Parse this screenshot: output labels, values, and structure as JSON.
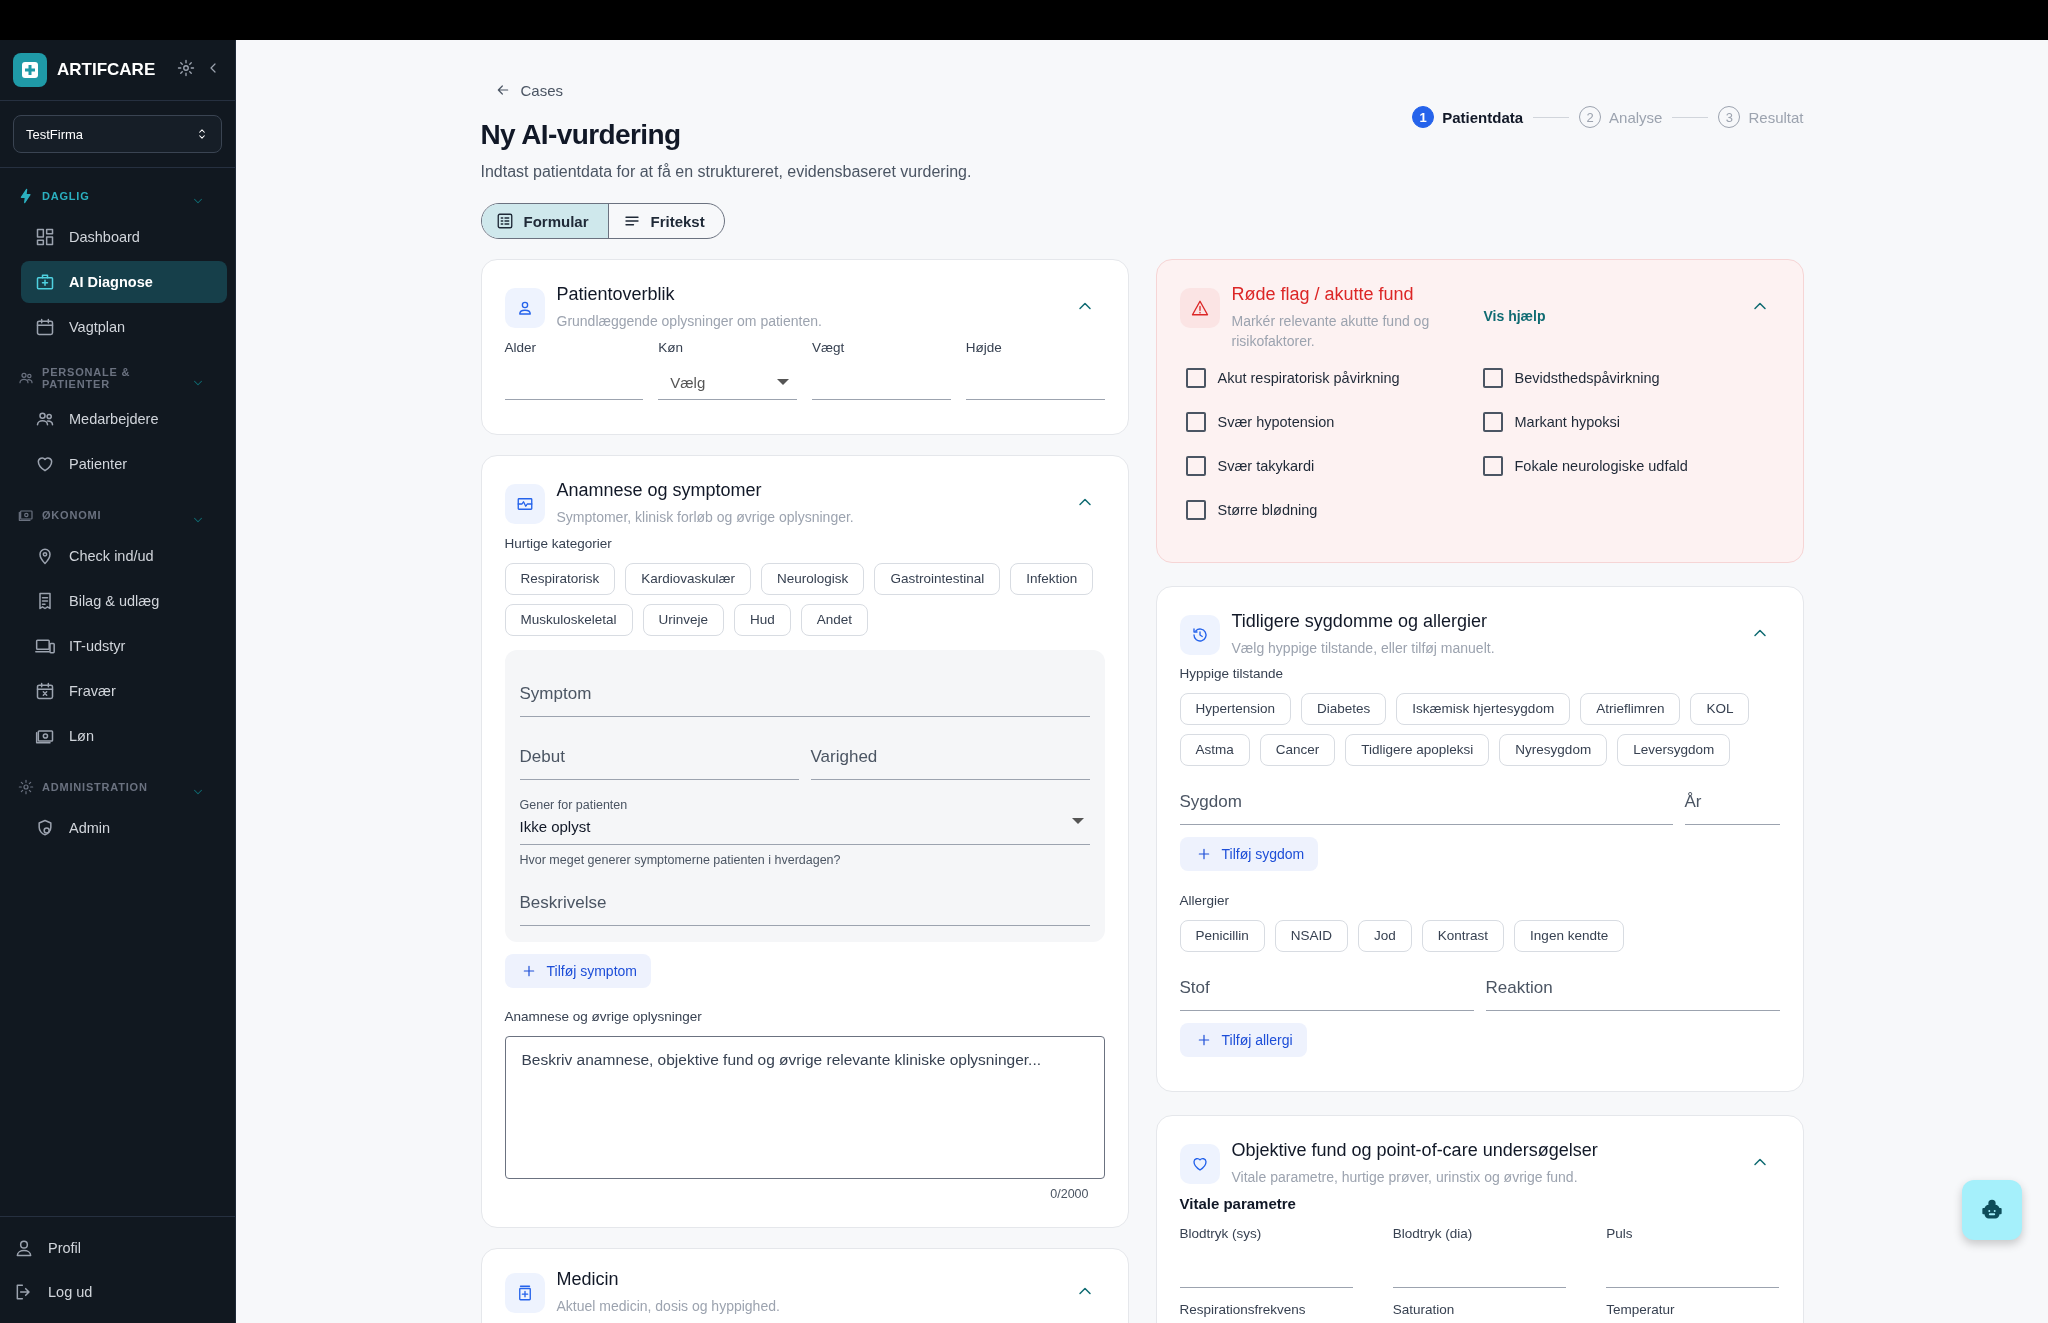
{
  "sidebar": {
    "brand": "ARTIFCARE",
    "company": "TestFirma",
    "sections": [
      {
        "title": "DAGLIG",
        "active": true,
        "expanded": true,
        "items": [
          {
            "label": "Dashboard",
            "selected": false
          },
          {
            "label": "AI Diagnose",
            "selected": true
          },
          {
            "label": "Vagtplan",
            "selected": false
          }
        ]
      },
      {
        "title": "PERSONALE & PATIENTER",
        "active": false,
        "expanded": true,
        "items": [
          {
            "label": "Medarbejdere",
            "selected": false
          },
          {
            "label": "Patienter",
            "selected": false
          }
        ]
      },
      {
        "title": "ØKONOMI",
        "active": false,
        "expanded": true,
        "items": [
          {
            "label": "Check ind/ud",
            "selected": false
          },
          {
            "label": "Bilag & udlæg",
            "selected": false
          },
          {
            "label": "IT-udstyr",
            "selected": false
          },
          {
            "label": "Fravær",
            "selected": false
          },
          {
            "label": "Løn",
            "selected": false
          }
        ]
      },
      {
        "title": "ADMINISTRATION",
        "active": false,
        "expanded": true,
        "items": [
          {
            "label": "Admin",
            "selected": false
          }
        ]
      }
    ],
    "footer": [
      "Profil",
      "Log ud"
    ]
  },
  "breadcrumb": "Cases",
  "title": "Ny AI-vurdering",
  "subtitle": "Indtast patientdata for at få en struktureret, evidensbaseret vurdering.",
  "view_toggle": [
    {
      "label": "Formular",
      "selected": true
    },
    {
      "label": "Fritekst",
      "selected": false
    }
  ],
  "stepper": [
    {
      "number": "1",
      "label": "Patientdata",
      "selected": true
    },
    {
      "number": "2",
      "label": "Analyse",
      "selected": false
    },
    {
      "number": "3",
      "label": "Resultat",
      "selected": false
    }
  ],
  "patient_overview": {
    "title": "Patientoverblik",
    "subtitle": "Grundlæggende oplysninger om patienten.",
    "expanded": true,
    "fields": [
      {
        "label": "Alder",
        "kind": "text"
      },
      {
        "label": "Køn",
        "kind": "select",
        "placeholder": "Vælg"
      },
      {
        "label": "Vægt",
        "kind": "text"
      },
      {
        "label": "Højde",
        "kind": "text"
      }
    ]
  },
  "anamnesis": {
    "title": "Anamnese og symptomer",
    "subtitle": "Symptomer, klinisk forløb og øvrige oplysninger.",
    "expanded": true,
    "chips_label": "Hurtige kategorier",
    "chips": [
      "Respiratorisk",
      "Kardiovaskulær",
      "Neurologisk",
      "Gastrointestinal",
      "Infektion",
      "Muskuloskeletal",
      "Urinveje",
      "Hud",
      "Andet"
    ],
    "symptom": {
      "name_label": "Symptom",
      "onset_label": "Debut",
      "duration_label": "Varighed",
      "burden_label": "Gener for patienten",
      "burden_value": "Ikke oplyst",
      "burden_helper": "Hvor meget generer symptomerne patienten i hverdagen?",
      "description_label": "Beskrivelse"
    },
    "add_button": "Tilføj symptom",
    "notes_label": "Anamnese og øvrige oplysninger",
    "notes_placeholder": "Beskriv anamnese, objektive fund og øvrige relevante kliniske oplysninger...",
    "notes_counter": "0/2000"
  },
  "medicine": {
    "title": "Medicin",
    "subtitle": "Aktuel medicin, dosis og hyppighed.",
    "expanded": true
  },
  "red_flags": {
    "title": "Røde flag / akutte fund",
    "subtitle": "Markér relevante akutte fund og risikofaktorer.",
    "help_link": "Vis hjælp",
    "expanded": true,
    "items": [
      {
        "label": "Akut respiratorisk påvirkning",
        "checked": false
      },
      {
        "label": "Bevidsthedspåvirkning",
        "checked": false
      },
      {
        "label": "Svær hypotension",
        "checked": false
      },
      {
        "label": "Markant hypoksi",
        "checked": false
      },
      {
        "label": "Svær takykardi",
        "checked": false
      },
      {
        "label": "Fokale neurologiske udfald",
        "checked": false
      },
      {
        "label": "Større blødning",
        "checked": false
      }
    ]
  },
  "history": {
    "title": "Tidligere sygdomme og allergier",
    "subtitle": "Vælg hyppige tilstande, eller tilføj manuelt.",
    "expanded": true,
    "conditions_label": "Hyppige tilstande",
    "conditions": [
      "Hypertension",
      "Diabetes",
      "Iskæmisk hjertesygdom",
      "Atrieflimren",
      "KOL",
      "Astma",
      "Cancer",
      "Tidligere apopleksi",
      "Nyresygdom",
      "Leversygdom"
    ],
    "disease_label": "Sygdom",
    "year_label": "År",
    "add_disease": "Tilføj sygdom",
    "allergies_label": "Allergier",
    "allergies": [
      "Penicillin",
      "NSAID",
      "Jod",
      "Kontrast",
      "Ingen kendte"
    ],
    "substance_label": "Stof",
    "reaction_label": "Reaktion",
    "add_allergy": "Tilføj allergi"
  },
  "objective": {
    "title": "Objektive fund og point-of-care undersøgelser",
    "subtitle": "Vitale parametre, hurtige prøver, urinstix og øvrige fund.",
    "expanded": true,
    "vitals_label": "Vitale parametre",
    "vitals": [
      "Blodtryk (sys)",
      "Blodtryk (dia)",
      "Puls",
      "Respirationsfrekvens",
      "Saturation",
      "Temperatur"
    ]
  }
}
